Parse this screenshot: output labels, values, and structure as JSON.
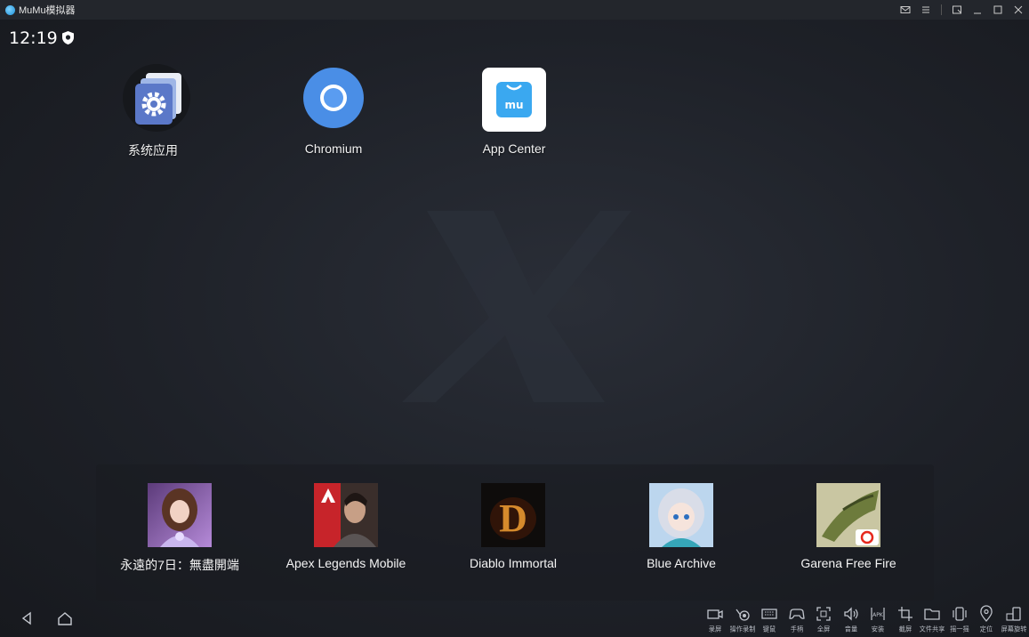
{
  "window": {
    "title": "MuMu模拟器",
    "controls": [
      "mail-icon",
      "menu-icon",
      "restore-icon",
      "minimize-icon",
      "maximize-icon",
      "close-icon"
    ]
  },
  "status_bar": {
    "time": "12:19",
    "icon": "shield-icon"
  },
  "home_apps": [
    {
      "label": "系统应用",
      "icon": "settings-folder-icon"
    },
    {
      "label": "Chromium",
      "icon": "chromium-icon"
    },
    {
      "label": "App Center",
      "icon": "app-center-icon"
    }
  ],
  "dock_apps": [
    {
      "label": "永遠的7日：無盡開端",
      "icon": "game-thumbnail-eternal-7"
    },
    {
      "label": "Apex Legends Mobile",
      "icon": "game-thumbnail-apex"
    },
    {
      "label": "Diablo Immortal",
      "icon": "game-thumbnail-diablo"
    },
    {
      "label": "Blue Archive",
      "icon": "game-thumbnail-blue-archive"
    },
    {
      "label": "Garena Free Fire",
      "icon": "game-thumbnail-free-fire"
    }
  ],
  "nav": {
    "back_icon": "back-triangle-icon",
    "home_icon": "home-icon"
  },
  "toolbar": [
    {
      "label": "录屏",
      "icon": "record-video-icon"
    },
    {
      "label": "操作录制",
      "icon": "macro-record-icon"
    },
    {
      "label": "键鼠",
      "icon": "keyboard-icon"
    },
    {
      "label": "手柄",
      "icon": "gamepad-icon"
    },
    {
      "label": "全屏",
      "icon": "fullscreen-icon"
    },
    {
      "label": "音量",
      "icon": "volume-icon"
    },
    {
      "label": "安装",
      "icon": "apk-install-icon"
    },
    {
      "label": "截屏",
      "icon": "screenshot-icon"
    },
    {
      "label": "文件共享",
      "icon": "folder-share-icon"
    },
    {
      "label": "摇一摇",
      "icon": "shake-icon"
    },
    {
      "label": "定位",
      "icon": "location-icon"
    },
    {
      "label": "屏幕旋转",
      "icon": "rotate-screen-icon"
    }
  ],
  "colors": {
    "background": "#1e2128",
    "titlebar": "#23262c",
    "chromium_blue": "#4a8ee6",
    "app_center_blue": "#3aa8f0"
  }
}
